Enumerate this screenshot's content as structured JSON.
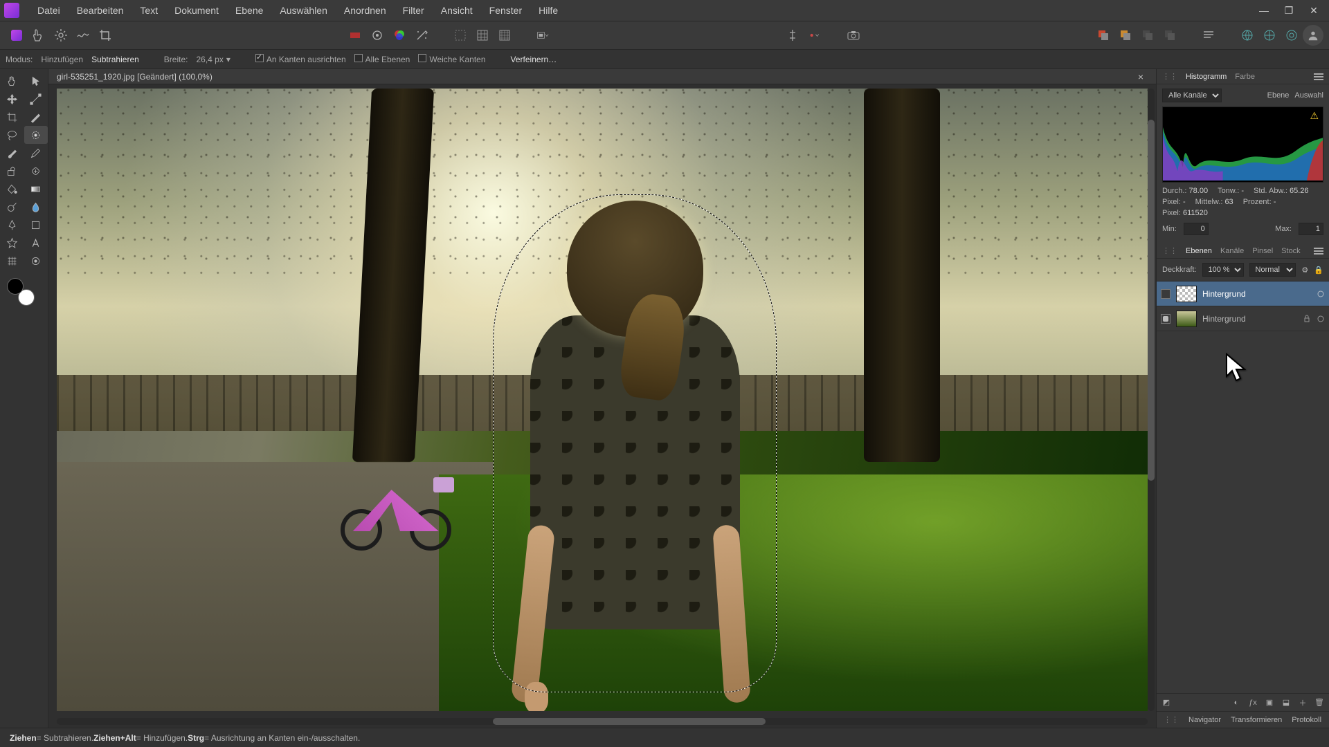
{
  "menu": {
    "items": [
      "Datei",
      "Bearbeiten",
      "Text",
      "Dokument",
      "Ebene",
      "Auswählen",
      "Anordnen",
      "Filter",
      "Ansicht",
      "Fenster",
      "Hilfe"
    ]
  },
  "window": {
    "min": "—",
    "max": "❐",
    "close": "✕"
  },
  "toolbar": {
    "icons": [
      "logo-gradient",
      "touch-icon",
      "gear-icon",
      "wave-icon",
      "crop-icon"
    ],
    "center1": [
      "red-swatch-icon",
      "circle-mask-icon",
      "rgb-wheel-icon",
      "wand-sparkle-icon"
    ],
    "grid": [
      "grid-none-icon",
      "grid-3x3-icon",
      "grid-dense-icon"
    ],
    "docfit": "fit-icon",
    "align": [
      "align-v-icon",
      "align-dot-icon"
    ],
    "cam": "camera-icon",
    "overlap": [
      "overlap-red-icon",
      "overlap-orange-icon",
      "overlap-grey-icon",
      "overlap-grey2-icon"
    ],
    "justify": "justify-icon",
    "globes": [
      "globe-a",
      "globe-b",
      "globe-c"
    ],
    "account": "account-icon"
  },
  "optbar": {
    "mode_label": "Modus:",
    "mode_add": "Hinzufügen",
    "mode_sub": "Subtrahieren",
    "width_label": "Breite:",
    "width_value": "26,4 px",
    "edge_snap": "An Kanten ausrichten",
    "all_layers": "Alle Ebenen",
    "soft_edges": "Weiche Kanten",
    "refine": "Verfeinern…"
  },
  "tools_left": [
    [
      "hand-tool",
      "pointer-tool"
    ],
    [
      "move-tool",
      "node-tool"
    ],
    [
      "crop2-tool",
      "slice-tool"
    ],
    [
      "lasso-tool",
      "marquee-tool"
    ],
    [
      "brush-tool",
      "pencil-tool"
    ],
    [
      "clone-tool",
      "heal-tool"
    ],
    [
      "fill-tool",
      "gradient-tool"
    ],
    [
      "dodge-tool",
      "blur-drop-tool"
    ],
    [
      "pen-tool",
      "shape-tool"
    ],
    [
      "star-tool",
      "text-tool"
    ],
    [
      "grid-tool",
      "eyedropper-tool"
    ]
  ],
  "document": {
    "tab_title": "girl-535251_1920.jpg [Geändert] (100,0%)"
  },
  "hist_panel": {
    "tabs": [
      "Histogramm",
      "Farbe"
    ],
    "channels": "Alle Kanäle",
    "rtabs": [
      "Ebene",
      "Auswahl"
    ],
    "stats": {
      "durch_label": "Durch.:",
      "durch": "78.00",
      "std_label": "Std. Abw.:",
      "std": "65.26",
      "mittel_label": "Mittelw.:",
      "mittel": "63",
      "pixel_label": "Pixel:",
      "pixel": "611520",
      "tonw_label": "Tonw.:",
      "tonw": "-",
      "pixel2_label": "Pixel:",
      "pixel2": "-",
      "prozent_label": "Prozent:",
      "prozent": "-"
    },
    "min_label": "Min:",
    "min": "0",
    "max_label": "Max:",
    "max": "1"
  },
  "layers_panel": {
    "tabs": [
      "Ebenen",
      "Kanäle",
      "Pinsel",
      "Stock"
    ],
    "opacity_label": "Deckkraft:",
    "opacity": "100 %",
    "blend": "Normal",
    "layers": [
      {
        "name": "Hintergrund",
        "visible": false,
        "selected": true,
        "thumb": "checker"
      },
      {
        "name": "Hintergrund",
        "visible": true,
        "selected": false,
        "thumb": "img",
        "locked": true
      }
    ],
    "foot_icons": [
      "mask-icon",
      "adjust-icon",
      "fx-icon",
      "group-icon",
      "add-icon",
      "delete-icon"
    ],
    "bottom_tabs": [
      "Navigator",
      "Transformieren",
      "Protokoll"
    ]
  },
  "status": {
    "text1": "Ziehen",
    "eq1": " = Subtrahieren. ",
    "text2": "Ziehen+Alt",
    "eq2": " = Hinzufügen. ",
    "text3": "Strg",
    "eq3": " = Ausrichtung an Kanten ein-/ausschalten."
  },
  "colors": {
    "swatch_fg": "#000000",
    "swatch_bg": "#ffffff"
  }
}
